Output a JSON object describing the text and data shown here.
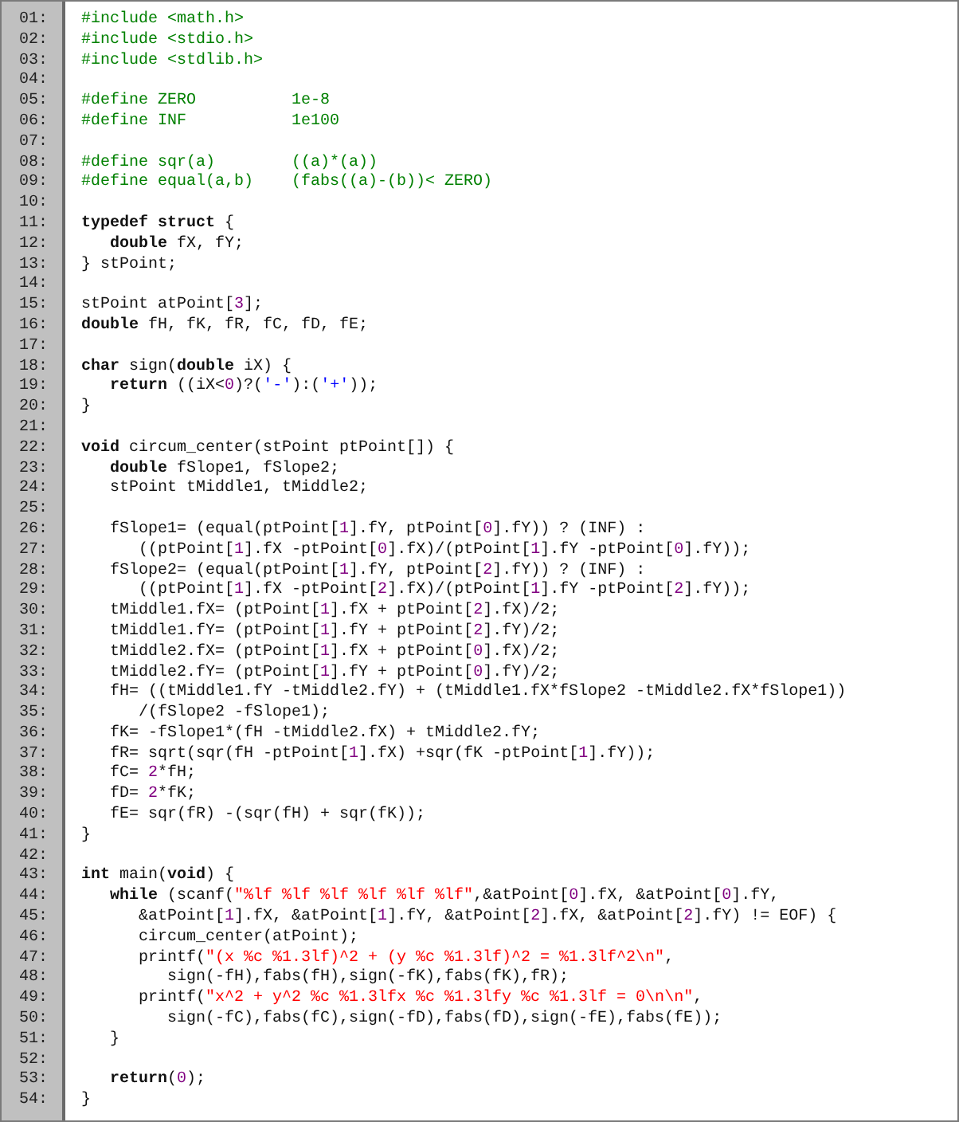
{
  "lines": [
    {
      "number": "01:",
      "tokens": [
        {
          "kind": "directive",
          "text": "#include <math.h>"
        }
      ]
    },
    {
      "number": "02:",
      "tokens": [
        {
          "kind": "directive",
          "text": "#include <stdio.h>"
        }
      ]
    },
    {
      "number": "03:",
      "tokens": [
        {
          "kind": "directive",
          "text": "#include <stdlib.h>"
        }
      ]
    },
    {
      "number": "04:"
    },
    {
      "number": "05:",
      "tokens": [
        {
          "kind": "directive",
          "text": "#define ZERO          1e-8"
        }
      ]
    },
    {
      "number": "06:",
      "tokens": [
        {
          "kind": "directive",
          "text": "#define INF           1e100"
        }
      ]
    },
    {
      "number": "07:"
    },
    {
      "number": "08:",
      "tokens": [
        {
          "kind": "directive",
          "text": "#define sqr(a)        ((a)*(a))"
        }
      ]
    },
    {
      "number": "09:",
      "tokens": [
        {
          "kind": "directive",
          "text": "#define equal(a,b)    (fabs((a)-(b))< ZERO)"
        }
      ]
    },
    {
      "number": "10:"
    },
    {
      "number": "11:",
      "tokens": [
        {
          "kind": "keyword",
          "text": "typedef"
        },
        {
          "kind": "keyword",
          "text": " struct"
        },
        {
          "kind": "plain",
          "text": " {"
        }
      ]
    },
    {
      "number": "12:",
      "tokens": [
        {
          "kind": "keyword",
          "text": "   double"
        },
        {
          "kind": "plain",
          "text": " fX, fY;"
        }
      ]
    },
    {
      "number": "13:",
      "tokens": [
        {
          "kind": "plain",
          "text": "} stPoint;"
        }
      ]
    },
    {
      "number": "14:"
    },
    {
      "number": "15:",
      "tokens": [
        {
          "kind": "plain",
          "text": "stPoint atPoint["
        },
        {
          "kind": "number",
          "text": "3"
        },
        {
          "kind": "plain",
          "text": "];"
        }
      ]
    },
    {
      "number": "16:",
      "tokens": [
        {
          "kind": "keyword",
          "text": "double"
        },
        {
          "kind": "plain",
          "text": " fH, fK, fR, fC, fD, fE;"
        }
      ]
    },
    {
      "number": "17:"
    },
    {
      "number": "18:",
      "tokens": [
        {
          "kind": "keyword",
          "text": "char"
        },
        {
          "kind": "plain",
          "text": " sign("
        },
        {
          "kind": "keyword",
          "text": "double"
        },
        {
          "kind": "plain",
          "text": " iX) {"
        }
      ]
    },
    {
      "number": "19:",
      "tokens": [
        {
          "kind": "keyword",
          "text": "   return"
        },
        {
          "kind": "plain",
          "text": " ((iX<"
        },
        {
          "kind": "number",
          "text": "0"
        },
        {
          "kind": "plain",
          "text": ")?("
        },
        {
          "kind": "char",
          "text": "'-'"
        },
        {
          "kind": "plain",
          "text": "):("
        },
        {
          "kind": "char",
          "text": "'+'"
        },
        {
          "kind": "plain",
          "text": "));"
        }
      ]
    },
    {
      "number": "20:",
      "tokens": [
        {
          "kind": "plain",
          "text": "}"
        }
      ]
    },
    {
      "number": "21:"
    },
    {
      "number": "22:",
      "tokens": [
        {
          "kind": "keyword",
          "text": "void"
        },
        {
          "kind": "plain",
          "text": " circum_center(stPoint ptPoint[]) {"
        }
      ]
    },
    {
      "number": "23:",
      "tokens": [
        {
          "kind": "keyword",
          "text": "   double"
        },
        {
          "kind": "plain",
          "text": " fSlope1, fSlope2;"
        }
      ]
    },
    {
      "number": "24:",
      "tokens": [
        {
          "kind": "plain",
          "text": "   stPoint tMiddle1, tMiddle2;"
        }
      ]
    },
    {
      "number": "25:"
    },
    {
      "number": "26:",
      "tokens": [
        {
          "kind": "plain",
          "text": "   fSlope1= (equal(ptPoint["
        },
        {
          "kind": "number",
          "text": "1"
        },
        {
          "kind": "plain",
          "text": "].fY, ptPoint["
        },
        {
          "kind": "number",
          "text": "0"
        },
        {
          "kind": "plain",
          "text": "].fY)) ? (INF) :"
        }
      ]
    },
    {
      "number": "27:",
      "tokens": [
        {
          "kind": "plain",
          "text": "      ((ptPoint["
        },
        {
          "kind": "number",
          "text": "1"
        },
        {
          "kind": "plain",
          "text": "].fX -ptPoint["
        },
        {
          "kind": "number",
          "text": "0"
        },
        {
          "kind": "plain",
          "text": "].fX)/(ptPoint["
        },
        {
          "kind": "number",
          "text": "1"
        },
        {
          "kind": "plain",
          "text": "].fY -ptPoint["
        },
        {
          "kind": "number",
          "text": "0"
        },
        {
          "kind": "plain",
          "text": "].fY));"
        }
      ]
    },
    {
      "number": "28:",
      "tokens": [
        {
          "kind": "plain",
          "text": "   fSlope2= (equal(ptPoint["
        },
        {
          "kind": "number",
          "text": "1"
        },
        {
          "kind": "plain",
          "text": "].fY, ptPoint["
        },
        {
          "kind": "number",
          "text": "2"
        },
        {
          "kind": "plain",
          "text": "].fY)) ? (INF) :"
        }
      ]
    },
    {
      "number": "29:",
      "tokens": [
        {
          "kind": "plain",
          "text": "      ((ptPoint["
        },
        {
          "kind": "number",
          "text": "1"
        },
        {
          "kind": "plain",
          "text": "].fX -ptPoint["
        },
        {
          "kind": "number",
          "text": "2"
        },
        {
          "kind": "plain",
          "text": "].fX)/(ptPoint["
        },
        {
          "kind": "number",
          "text": "1"
        },
        {
          "kind": "plain",
          "text": "].fY -ptPoint["
        },
        {
          "kind": "number",
          "text": "2"
        },
        {
          "kind": "plain",
          "text": "].fY));"
        }
      ]
    },
    {
      "number": "30:",
      "tokens": [
        {
          "kind": "plain",
          "text": "   tMiddle1.fX= (ptPoint["
        },
        {
          "kind": "number",
          "text": "1"
        },
        {
          "kind": "plain",
          "text": "].fX + ptPoint["
        },
        {
          "kind": "number",
          "text": "2"
        },
        {
          "kind": "plain",
          "text": "].fX)/2;"
        }
      ]
    },
    {
      "number": "31:",
      "tokens": [
        {
          "kind": "plain",
          "text": "   tMiddle1.fY= (ptPoint["
        },
        {
          "kind": "number",
          "text": "1"
        },
        {
          "kind": "plain",
          "text": "].fY + ptPoint["
        },
        {
          "kind": "number",
          "text": "2"
        },
        {
          "kind": "plain",
          "text": "].fY)/2;"
        }
      ]
    },
    {
      "number": "32:",
      "tokens": [
        {
          "kind": "plain",
          "text": "   tMiddle2.fX= (ptPoint["
        },
        {
          "kind": "number",
          "text": "1"
        },
        {
          "kind": "plain",
          "text": "].fX + ptPoint["
        },
        {
          "kind": "number",
          "text": "0"
        },
        {
          "kind": "plain",
          "text": "].fX)/2;"
        }
      ]
    },
    {
      "number": "33:",
      "tokens": [
        {
          "kind": "plain",
          "text": "   tMiddle2.fY= (ptPoint["
        },
        {
          "kind": "number",
          "text": "1"
        },
        {
          "kind": "plain",
          "text": "].fY + ptPoint["
        },
        {
          "kind": "number",
          "text": "0"
        },
        {
          "kind": "plain",
          "text": "].fY)/2;"
        }
      ]
    },
    {
      "number": "34:",
      "tokens": [
        {
          "kind": "plain",
          "text": "   fH= ((tMiddle1.fY -tMiddle2.fY) + (tMiddle1.fX*fSlope2 -tMiddle2.fX*fSlope1))"
        }
      ]
    },
    {
      "number": "35:",
      "tokens": [
        {
          "kind": "plain",
          "text": "      /(fSlope2 -fSlope1);"
        }
      ]
    },
    {
      "number": "36:",
      "tokens": [
        {
          "kind": "plain",
          "text": "   fK= -fSlope1*(fH -tMiddle2.fX) + tMiddle2.fY;"
        }
      ]
    },
    {
      "number": "37:",
      "tokens": [
        {
          "kind": "plain",
          "text": "   fR= sqrt(sqr(fH -ptPoint["
        },
        {
          "kind": "number",
          "text": "1"
        },
        {
          "kind": "plain",
          "text": "].fX) +sqr(fK -ptPoint["
        },
        {
          "kind": "number",
          "text": "1"
        },
        {
          "kind": "plain",
          "text": "].fY));"
        }
      ]
    },
    {
      "number": "38:",
      "tokens": [
        {
          "kind": "plain",
          "text": "   fC= "
        },
        {
          "kind": "number",
          "text": "2"
        },
        {
          "kind": "plain",
          "text": "*fH;"
        }
      ]
    },
    {
      "number": "39:",
      "tokens": [
        {
          "kind": "plain",
          "text": "   fD= "
        },
        {
          "kind": "number",
          "text": "2"
        },
        {
          "kind": "plain",
          "text": "*fK;"
        }
      ]
    },
    {
      "number": "40:",
      "tokens": [
        {
          "kind": "plain",
          "text": "   fE= sqr(fR) -(sqr(fH) + sqr(fK));"
        }
      ]
    },
    {
      "number": "41:",
      "tokens": [
        {
          "kind": "plain",
          "text": "}"
        }
      ]
    },
    {
      "number": "42:"
    },
    {
      "number": "43:",
      "tokens": [
        {
          "kind": "keyword",
          "text": "int"
        },
        {
          "kind": "plain",
          "text": " main("
        },
        {
          "kind": "keyword",
          "text": "void"
        },
        {
          "kind": "plain",
          "text": ") {"
        }
      ]
    },
    {
      "number": "44:",
      "tokens": [
        {
          "kind": "keyword",
          "text": "   while"
        },
        {
          "kind": "plain",
          "text": " (scanf("
        },
        {
          "kind": "string",
          "text": "\"%lf %lf %lf %lf %lf %lf\""
        },
        {
          "kind": "plain",
          "text": ",&atPoint["
        },
        {
          "kind": "number",
          "text": "0"
        },
        {
          "kind": "plain",
          "text": "].fX, &atPoint["
        },
        {
          "kind": "number",
          "text": "0"
        },
        {
          "kind": "plain",
          "text": "].fY,"
        }
      ]
    },
    {
      "number": "45:",
      "tokens": [
        {
          "kind": "plain",
          "text": "      &atPoint["
        },
        {
          "kind": "number",
          "text": "1"
        },
        {
          "kind": "plain",
          "text": "].fX, &atPoint["
        },
        {
          "kind": "number",
          "text": "1"
        },
        {
          "kind": "plain",
          "text": "].fY, &atPoint["
        },
        {
          "kind": "number",
          "text": "2"
        },
        {
          "kind": "plain",
          "text": "].fX, &atPoint["
        },
        {
          "kind": "number",
          "text": "2"
        },
        {
          "kind": "plain",
          "text": "].fY) != EOF) {"
        }
      ]
    },
    {
      "number": "46:",
      "tokens": [
        {
          "kind": "plain",
          "text": "      circum_center(atPoint);"
        }
      ]
    },
    {
      "number": "47:",
      "tokens": [
        {
          "kind": "plain",
          "text": "      printf("
        },
        {
          "kind": "string",
          "text": "\"(x %c %1.3lf)^2 + (y %c %1.3lf)^2 = %1.3lf^2\\n\""
        },
        {
          "kind": "plain",
          "text": ","
        }
      ]
    },
    {
      "number": "48:",
      "tokens": [
        {
          "kind": "plain",
          "text": "         sign(-fH),fabs(fH),sign(-fK),fabs(fK),fR);"
        }
      ]
    },
    {
      "number": "49:",
      "tokens": [
        {
          "kind": "plain",
          "text": "      printf("
        },
        {
          "kind": "string",
          "text": "\"x^2 + y^2 %c %1.3lfx %c %1.3lfy %c %1.3lf = 0\\n\\n\""
        },
        {
          "kind": "plain",
          "text": ","
        }
      ]
    },
    {
      "number": "50:",
      "tokens": [
        {
          "kind": "plain",
          "text": "         sign(-fC),fabs(fC),sign(-fD),fabs(fD),sign(-fE),fabs(fE));"
        }
      ]
    },
    {
      "number": "51:",
      "tokens": [
        {
          "kind": "plain",
          "text": "   }"
        }
      ]
    },
    {
      "number": "52:"
    },
    {
      "number": "53:",
      "tokens": [
        {
          "kind": "keyword",
          "text": "   return"
        },
        {
          "kind": "plain",
          "text": "("
        },
        {
          "kind": "number",
          "text": "0"
        },
        {
          "kind": "plain",
          "text": ");"
        }
      ]
    },
    {
      "number": "54:",
      "tokens": [
        {
          "kind": "plain",
          "text": "}"
        }
      ]
    }
  ]
}
